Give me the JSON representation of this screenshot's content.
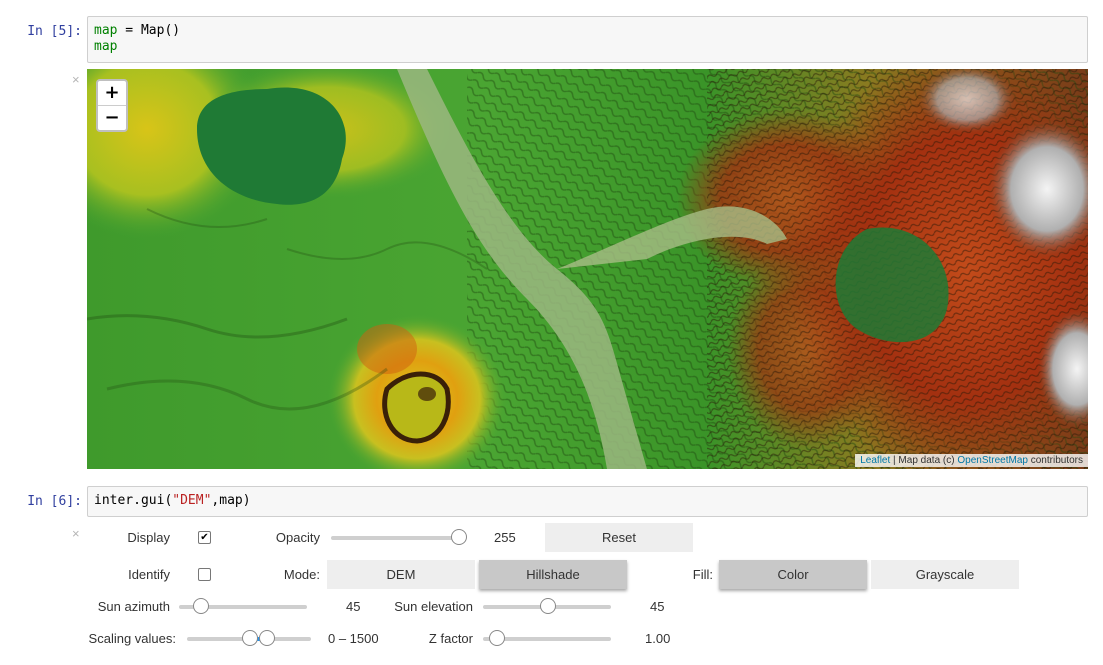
{
  "cells": [
    {
      "prompt": "In [5]:",
      "code_lines": [
        [
          {
            "t": "map",
            "c": "var"
          },
          {
            "t": " = Map()",
            "c": "plain"
          }
        ],
        [
          {
            "t": "map",
            "c": "var"
          }
        ]
      ]
    },
    {
      "prompt": "In [6]:",
      "code_lines": [
        [
          {
            "t": "inter.gui(",
            "c": "plain"
          },
          {
            "t": "\"DEM\"",
            "c": "str"
          },
          {
            "t": ",map)",
            "c": "plain"
          }
        ]
      ]
    }
  ],
  "close_symbol": "×",
  "map": {
    "zoom_in": "+",
    "zoom_out": "−",
    "attribution": {
      "link1": "Leaflet",
      "sep": " | Map data (c) ",
      "link2": "OpenStreetMap",
      "suffix": " contributors"
    }
  },
  "widgets": {
    "display_label": "Display",
    "display_checked": true,
    "check_mark": "✔",
    "opacity_label": "Opacity",
    "opacity_value": "255",
    "opacity_fraction": 1.0,
    "reset_label": "Reset",
    "identify_label": "Identify",
    "identify_checked": false,
    "mode_label": "Mode:",
    "mode_options": [
      "DEM",
      "Hillshade"
    ],
    "mode_selected": "Hillshade",
    "fill_label": "Fill:",
    "fill_options": [
      "Color",
      "Grayscale"
    ],
    "fill_selected": "Color",
    "sun_azimuth_label": "Sun azimuth",
    "sun_azimuth_value": "45",
    "sun_azimuth_fraction": 0.125,
    "sun_elevation_label": "Sun elevation",
    "sun_elevation_value": "45",
    "sun_elevation_fraction": 0.5,
    "scaling_label": "Scaling values:",
    "scaling_value": "0 – 1500",
    "scaling_low_fraction": 0.5,
    "scaling_high_fraction": 0.65,
    "zfactor_label": "Z factor",
    "zfactor_value": "1.00",
    "zfactor_fraction": 0.05
  }
}
